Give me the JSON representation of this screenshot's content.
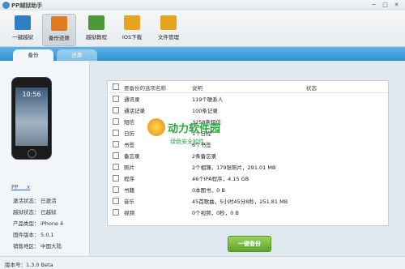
{
  "window": {
    "title": "PP越狱助手",
    "controls": [
      "─",
      "□",
      "✕"
    ]
  },
  "toolbar": {
    "items": [
      {
        "label": "一键越狱",
        "icon": "jailbreak-icon",
        "color": "#2f7fc4"
      },
      {
        "label": "备份还原",
        "icon": "backup-restore-icon",
        "color": "#e07a1e",
        "active": true
      },
      {
        "label": "越狱教程",
        "icon": "tutorial-icon",
        "color": "#4a9a3a"
      },
      {
        "label": "IOS下载",
        "icon": "download-icon",
        "color": "#e5a51f"
      },
      {
        "label": "文件管理",
        "icon": "folder-icon",
        "color": "#e5a51f"
      }
    ]
  },
  "tabs": [
    {
      "label": "备份",
      "active": true
    },
    {
      "label": "还原",
      "active": false
    }
  ],
  "device": {
    "screen_time": "10:56",
    "name": "PP___x",
    "info": [
      {
        "key": "激活状态：",
        "value": "已激活"
      },
      {
        "key": "越狱状态：",
        "value": "已越狱"
      },
      {
        "key": "产品类型：",
        "value": "iPhone 4"
      },
      {
        "key": "固件版本：",
        "value": "5.0.1"
      },
      {
        "key": "销售地区：",
        "value": "中国大陆"
      }
    ]
  },
  "table": {
    "headers": {
      "name": "要备份的选项名称",
      "desc": "说明",
      "status": "状态"
    },
    "rows": [
      {
        "name": "通讯录",
        "desc": "119个联系人"
      },
      {
        "name": "通话记录",
        "desc": "100条记录"
      },
      {
        "name": "短信",
        "desc": "3258条短信"
      },
      {
        "name": "日历",
        "desc": "1个日程"
      },
      {
        "name": "书签",
        "desc": "6个书签"
      },
      {
        "name": "备忘录",
        "desc": "2条备忘录"
      },
      {
        "name": "照片",
        "desc": "2个相簿，179张照片，291.01 MB"
      },
      {
        "name": "程序",
        "desc": "46个IPA程序，4.15 GB"
      },
      {
        "name": "书籍",
        "desc": "0本图书，0 B"
      },
      {
        "name": "音乐",
        "desc": "45首歌曲，5小时45分8秒，251.81 MB"
      },
      {
        "name": "视频",
        "desc": "0个视频，0秒，0 B"
      }
    ]
  },
  "actions": {
    "backup": "一键备份"
  },
  "status": {
    "version": "版本号：1.3.0 Beta"
  },
  "watermark": {
    "main": "动力软件园",
    "sub": "绿色安全软件"
  }
}
